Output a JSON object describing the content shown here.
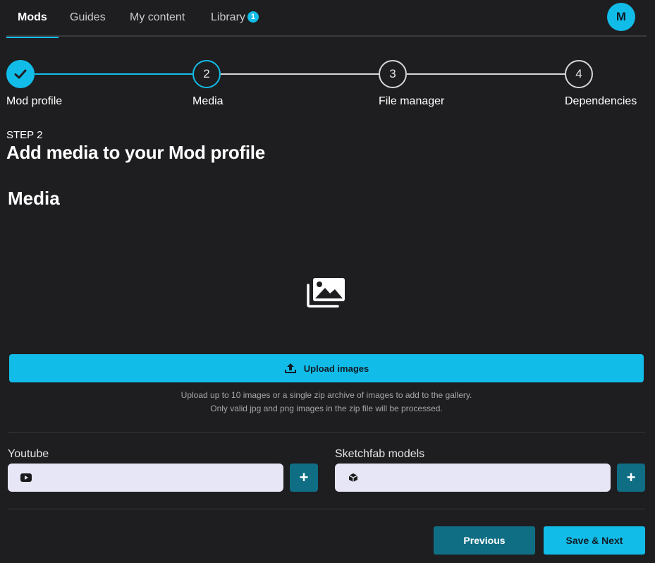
{
  "nav": {
    "tabs": [
      {
        "label": "Mods",
        "active": true
      },
      {
        "label": "Guides",
        "active": false
      },
      {
        "label": "My content",
        "active": false
      },
      {
        "label": "Library",
        "active": false
      }
    ],
    "library_badge": "1",
    "avatar_initial": "M"
  },
  "stepper": {
    "steps": [
      {
        "number": "",
        "label": "Mod profile",
        "state": "done"
      },
      {
        "number": "2",
        "label": "Media",
        "state": "current"
      },
      {
        "number": "3",
        "label": "File manager",
        "state": "upcoming"
      },
      {
        "number": "4",
        "label": "Dependencies",
        "state": "upcoming"
      }
    ]
  },
  "header": {
    "kicker": "STEP 2",
    "title": "Add media to your Mod profile"
  },
  "media": {
    "section_title": "Media",
    "upload_label": "Upload images",
    "help_line_1": "Upload up to 10 images or a single zip archive of images to add to the gallery.",
    "help_line_2": "Only valid jpg and png images in the zip file will be processed."
  },
  "inputs": {
    "youtube_label": "Youtube",
    "youtube_value": "",
    "sketchfab_label": "Sketchfab models",
    "sketchfab_value": "",
    "add_symbol": "+"
  },
  "footer": {
    "previous_label": "Previous",
    "next_label": "Save & Next"
  },
  "colors": {
    "background": "#1e1e20",
    "accent": "#12bce8",
    "accent_dark": "#0f6e84",
    "input_bg": "#e6e6f7"
  },
  "icons": [
    "checkmark-icon",
    "gallery-icon",
    "upload-icon",
    "youtube-icon",
    "cube-icon",
    "plus-icon"
  ]
}
